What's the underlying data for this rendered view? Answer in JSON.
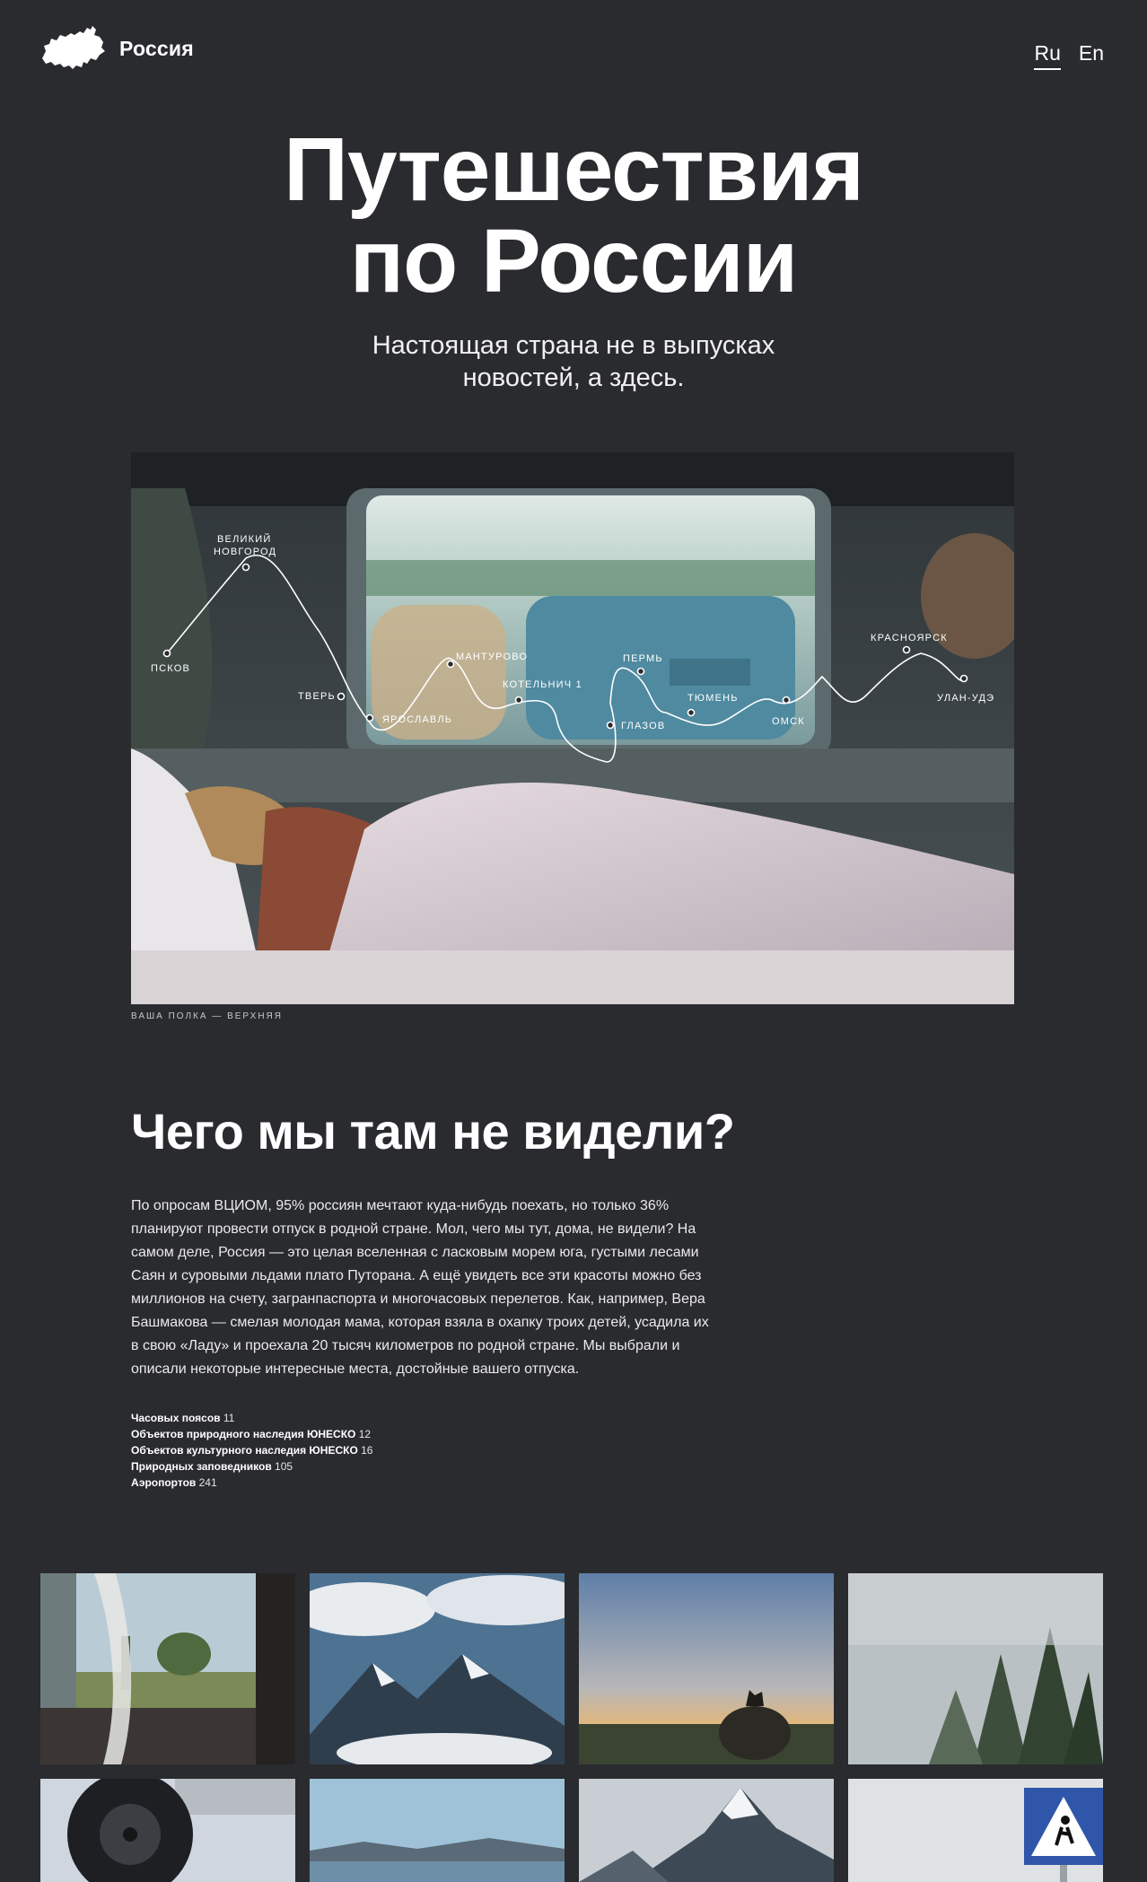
{
  "header": {
    "brand": "Россия",
    "lang_ru": "Ru",
    "lang_en": "En"
  },
  "hero": {
    "title_line1": "Путешествия",
    "title_line2": "по России",
    "subtitle_line1": "Настоящая страна не в выпусках",
    "subtitle_line2": "новостей, а здесь."
  },
  "route": {
    "stops": [
      "ПСКОВ",
      "ВЕЛИКИЙ",
      "НОВГОРОД",
      "ТВЕРЬ",
      "ЯРОСЛАВЛЬ",
      "МАНТУРОВО",
      "КОТЕЛЬНИЧ 1",
      "ГЛАЗОВ",
      "ПЕРМЬ",
      "ТЮМЕНЬ",
      "ОМСК",
      "КРАСНОЯРСК",
      "УЛАН-УДЭ"
    ]
  },
  "photo_caption": "ВАША ПОЛКА — ВЕРХНЯЯ",
  "section": {
    "title": "Чего мы там не видели?",
    "lines": [
      "По опросам ВЦИОМ, 95% россиян мечтают куда-нибудь поехать, но только 36%",
      "планируют провести отпуск в родной стране. Мол, чего мы тут, дома, не видели? На",
      "самом деле, Россия — это целая вселенная с ласковым морем юга, густыми лесами",
      "Саян и суровыми льдами плато Путорана. А ещё увидеть все эти красоты можно без",
      "миллионов на счету, загранпаспорта и многочасовых перелетов. Как, например, Вера",
      "Башмакова — смелая молодая мама, которая взяла в охапку троих детей, усадила их",
      "в свою «Ладу» и проехала 20 тысяч километров по родной стране. Мы выбрали и",
      "описали некоторые интересные места, достойные вашего отпуска."
    ]
  },
  "stats": [
    {
      "label": "Часовых поясов",
      "value": "11"
    },
    {
      "label": "Объектов природного наследия ЮНЕСКО",
      "value": "12"
    },
    {
      "label": "Объектов культурного наследия ЮНЕСКО",
      "value": "16"
    },
    {
      "label": "Природных заповедников",
      "value": "105"
    },
    {
      "label": "Аэропортов",
      "value": "241"
    }
  ],
  "colors": {
    "background": "#2a2b2f",
    "text": "#ffffff"
  }
}
